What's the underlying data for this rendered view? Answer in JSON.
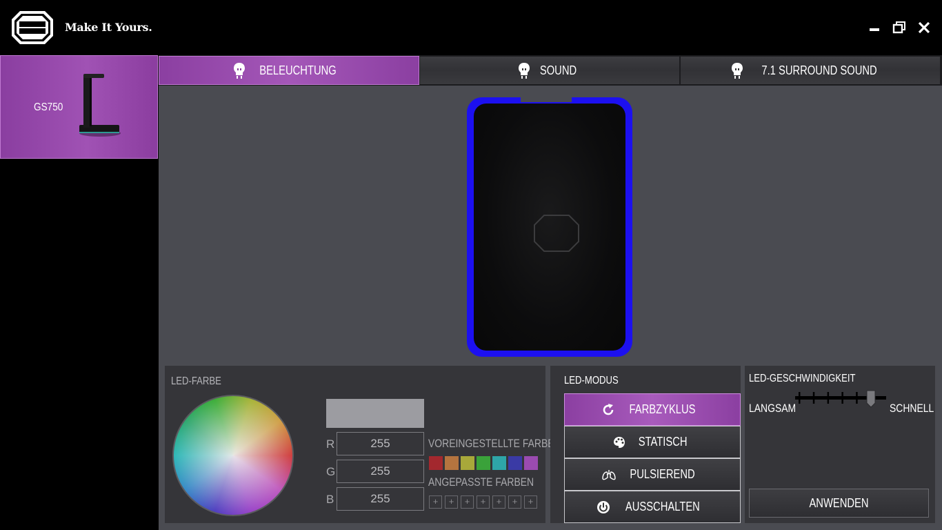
{
  "app": {
    "logo_text": "COOLER MASTER",
    "slogan": "Make It Yours."
  },
  "window_controls": {
    "minimize": "minimize-icon",
    "maximize": "restore-icon",
    "close": "close-icon"
  },
  "sidebar": {
    "devices": [
      {
        "name": "GS750",
        "selected": true
      }
    ]
  },
  "tabs": [
    {
      "label": "BELEUCHTUNG",
      "icon": "bulb-icon",
      "active": true
    },
    {
      "label": "SOUND",
      "icon": "bulb-icon",
      "active": false
    },
    {
      "label": "7.1 SURROUND SOUND",
      "icon": "bulb-icon",
      "active": false
    }
  ],
  "preview": {
    "led_color": "#1c10f0"
  },
  "led_color": {
    "title": "LED-FARBE",
    "current_color": "#9c9ca1",
    "r_label": "R",
    "g_label": "G",
    "b_label": "B",
    "r": "255",
    "g": "255",
    "b": "255",
    "preset_label": "VOREINGESTELLTE FARBEN",
    "presets": [
      "#a3282e",
      "#b5743f",
      "#a8a83a",
      "#3aa23a",
      "#2ea5a8",
      "#3a3aa5",
      "#9a4bb0"
    ],
    "custom_label": "ANGEPASSTE FARBEN",
    "custom_slots": [
      "+",
      "+",
      "+",
      "+",
      "+",
      "+",
      "+"
    ]
  },
  "led_mode": {
    "title": "LED-MODUS",
    "modes": [
      {
        "label": "FARBZYKLUS",
        "icon": "refresh-icon",
        "active": true
      },
      {
        "label": "STATISCH",
        "icon": "palette-icon",
        "active": false
      },
      {
        "label": "PULSIEREND",
        "icon": "lungs-icon",
        "active": false
      },
      {
        "label": "AUSSCHALTEN",
        "icon": "power-icon",
        "active": false
      }
    ]
  },
  "led_speed": {
    "title": "LED-GESCHWINDIGKEIT",
    "slow_label": "LANGSAM",
    "fast_label": "SCHNELL",
    "steps": 6,
    "value": 6,
    "apply_label": "ANWENDEN"
  }
}
